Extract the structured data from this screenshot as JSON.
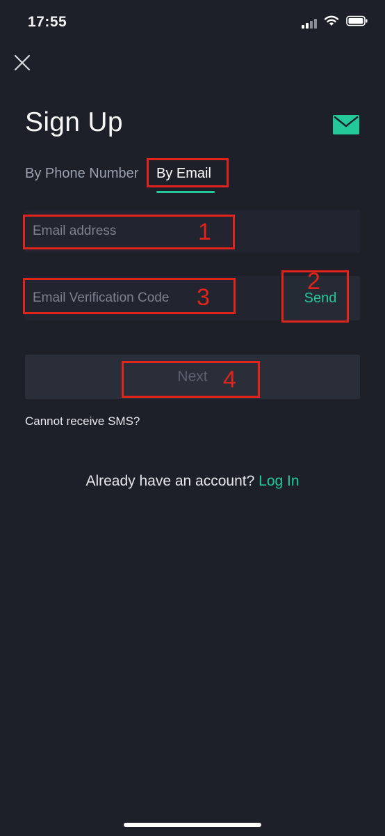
{
  "status_bar": {
    "time": "17:55",
    "icons": [
      "signal-icon",
      "wifi-icon",
      "battery-icon"
    ]
  },
  "header": {
    "close_icon": "close-icon",
    "title": "Sign Up",
    "mail_icon": "mail-icon"
  },
  "tabs": [
    {
      "label": "By Phone Number",
      "active": false
    },
    {
      "label": "By Email",
      "active": true
    }
  ],
  "form": {
    "email_placeholder": "Email address",
    "email_value": "",
    "code_placeholder": "Email Verification Code",
    "code_value": "",
    "send_label": "Send",
    "next_label": "Next",
    "sms_help": "Cannot receive SMS?"
  },
  "footer": {
    "prompt": "Already have an account?",
    "login_label": "Log In"
  },
  "annotations": [
    {
      "number": "1",
      "target": "email-address-field"
    },
    {
      "number": "2",
      "target": "send-code-button"
    },
    {
      "number": "3",
      "target": "email-verification-code-field"
    },
    {
      "number": "4",
      "target": "next-button"
    }
  ],
  "colors": {
    "background": "#1d2029",
    "accent": "#24c99a",
    "annotation": "#e0241b",
    "field": "#22252f",
    "muted_text": "#7d828e"
  }
}
